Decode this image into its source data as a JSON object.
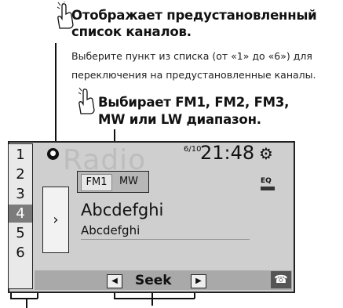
{
  "callouts": [
    {
      "title_line1": "Отображает предустановленный",
      "title_line2": "список каналов.",
      "text_line1": "Выберите пункт из списка (от «1» до «6») для",
      "text_line2": "переключения на предустановленные каналы."
    },
    {
      "title_line1": "Выбирает FM1, FM2, FM3,",
      "title_line2": "MW или LW диапазон."
    }
  ],
  "screen": {
    "watermark": "Radio",
    "presets": [
      "1",
      "2",
      "3",
      "4",
      "5",
      "6"
    ],
    "selected_preset": "4",
    "expand_glyph": "›",
    "bands": {
      "active": "FM1",
      "other": "MW"
    },
    "preset_indicator": "6/10",
    "clock": "21:48",
    "eq_label": "EQ",
    "station_title": "Abcdefghi",
    "station_subtitle": "Abcdefghi",
    "seek_label": "Seek",
    "icons": {
      "settings": "gear-icon",
      "phone": "phone-icon",
      "seek_prev": "triangle-left-icon",
      "seek_next": "triangle-right-icon",
      "hand": "hand-pointer-icon"
    }
  }
}
